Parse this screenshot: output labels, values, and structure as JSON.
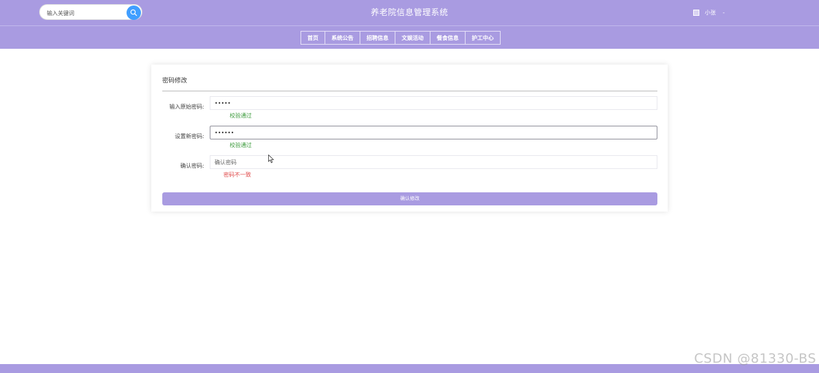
{
  "header": {
    "title": "养老院信息管理系统",
    "search": {
      "placeholder": "输入关键词",
      "value": ""
    },
    "user": {
      "name": "小张",
      "caret": "-"
    }
  },
  "nav": {
    "items": [
      {
        "label": "首页"
      },
      {
        "label": "系统公告"
      },
      {
        "label": "招聘信息"
      },
      {
        "label": "文娱活动"
      },
      {
        "label": "餐食信息"
      },
      {
        "label": "护工中心"
      }
    ]
  },
  "form": {
    "title": "密码修改",
    "fields": [
      {
        "label": "输入原始密码:",
        "value": "•••••",
        "placeholder": "",
        "hint": "校验通过",
        "hint_status": "ok"
      },
      {
        "label": "设置新密码:",
        "value": "••••••",
        "placeholder": "",
        "hint": "校验通过",
        "hint_status": "ok"
      },
      {
        "label": "确认密码:",
        "value": "",
        "placeholder": "确认密码",
        "hint": "密码不一致",
        "hint_status": "error"
      }
    ],
    "submit_label": "确认修改"
  },
  "watermark": "CSDN @81330-BS",
  "colors": {
    "theme": "#a99be1",
    "search_button": "#409eff",
    "hint_ok": "#3a9a3a",
    "hint_error": "#e04848"
  }
}
